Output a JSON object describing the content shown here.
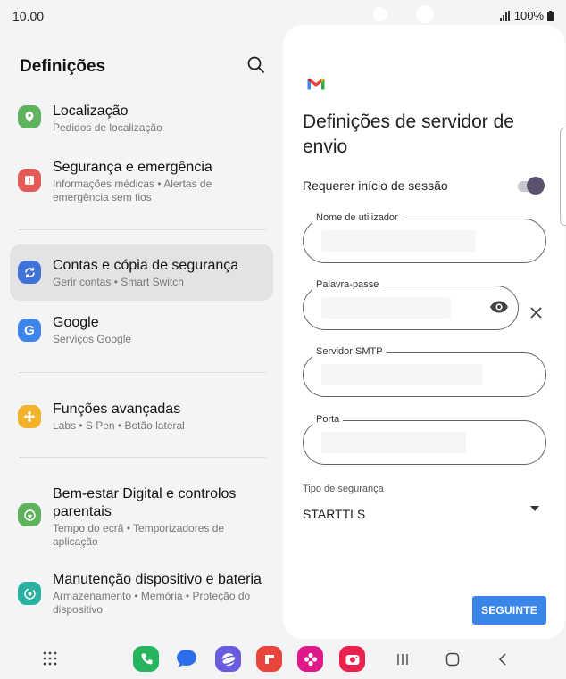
{
  "status": {
    "time": "10.00",
    "battery": "100%"
  },
  "settings": {
    "title": "Definições",
    "items": [
      {
        "title": "Localização",
        "subtitle": "Pedidos de localização",
        "color": "#5fb35e"
      },
      {
        "title": "Segurança e emergência",
        "subtitle": "Informações médicas • Alertas de emergência sem fios",
        "color": "#e35a57"
      },
      {
        "title": "Contas e cópia de segurança",
        "subtitle": "Gerir contas • Smart Switch",
        "color": "#3f73d8"
      },
      {
        "title": "Google",
        "subtitle": "Serviços Google",
        "color": "#3f84ea"
      },
      {
        "title": "Funções avançadas",
        "subtitle": "Labs • S Pen • Botão lateral",
        "color": "#f3b22c"
      },
      {
        "title": "Bem-estar Digital e controlos parentais",
        "subtitle": "Tempo do ecrã • Temporizadores de aplicação",
        "color": "#5fb35e"
      },
      {
        "title": "Manutenção dispositivo e bateria",
        "subtitle": "Armazenamento • Memória • Proteção do dispositivo",
        "color": "#2ab1a1"
      }
    ]
  },
  "gmail": {
    "title": "Definições de servidor de envio",
    "require_signin_label": "Requerer início de sessão",
    "require_signin": true,
    "fields": {
      "username": {
        "label": "Nome de utilizador"
      },
      "password": {
        "label": "Palavra-passe"
      },
      "smtp": {
        "label": "Servidor SMTP"
      },
      "port": {
        "label": "Porta"
      }
    },
    "security_label": "Tipo de segurança",
    "security_value": "STARTTLS",
    "next_button": "SEGUINTE"
  },
  "colors": {
    "accent": "#3a86e8",
    "toggle": "#5b5270"
  }
}
